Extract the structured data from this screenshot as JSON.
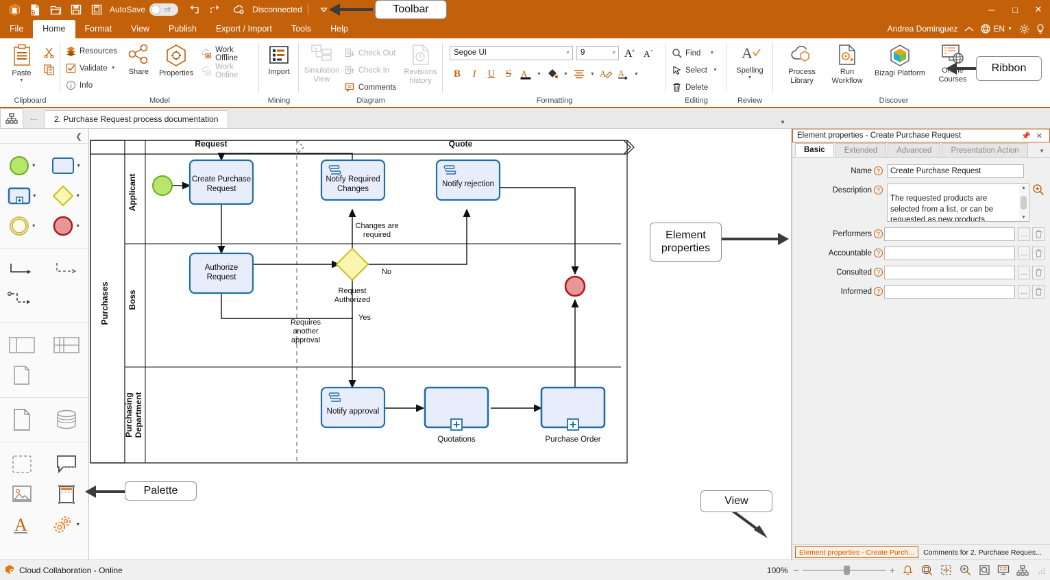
{
  "titlebar": {
    "icons": [
      "bizagi-logo-icon",
      "new-document-icon",
      "open-folder-icon",
      "save-icon",
      "save-as-icon"
    ],
    "autosave_label": "AutoSave",
    "autosave_state": "off",
    "undo_label": "undo-icon",
    "redo_label": "redo-icon",
    "connection_status": "Disconnected",
    "customize_label": "customize-quick-access-icon",
    "window_controls": [
      "minimize",
      "maximize",
      "close"
    ]
  },
  "menu": {
    "items": [
      "File",
      "Home",
      "Format",
      "View",
      "Publish",
      "Export / Import",
      "Tools",
      "Help"
    ],
    "active": "Home",
    "user": "Andrea Dominguez",
    "language": "EN",
    "right_icons": [
      "collapse-ribbon-icon",
      "globe-icon",
      "settings-gear-icon",
      "lightbulb-icon"
    ]
  },
  "ribbon": {
    "groups": [
      {
        "title": "Clipboard",
        "big": [
          {
            "label": "Paste",
            "icon": "paste-icon",
            "has_arrow": true,
            "disabled": false
          }
        ],
        "small": [
          {
            "label": "",
            "icon": "cut-icon",
            "disabled": false
          },
          {
            "label": "",
            "icon": "copy-icon",
            "disabled": false
          }
        ]
      },
      {
        "title": "Model",
        "small_left": [
          {
            "label": "Resources",
            "icon": "resources-icon",
            "disabled": false,
            "arrow": false
          },
          {
            "label": "Validate",
            "icon": "validate-icon",
            "disabled": false,
            "arrow": true
          },
          {
            "label": "Info",
            "icon": "info-icon",
            "disabled": false,
            "arrow": false
          }
        ],
        "big": [
          {
            "label": "Share",
            "icon": "share-icon",
            "disabled": false
          },
          {
            "label": "Properties",
            "icon": "properties-gear-icon",
            "disabled": false
          }
        ],
        "small_right": [
          {
            "label": "Work Offline",
            "icon": "work-offline-icon",
            "disabled": false
          },
          {
            "label": "Work Online",
            "icon": "work-online-icon",
            "disabled": true
          }
        ]
      },
      {
        "title": "Mining",
        "big": [
          {
            "label": "Import",
            "icon": "import-icon",
            "disabled": false
          }
        ]
      },
      {
        "title": "Diagram",
        "big": [
          {
            "label": "Simulation View",
            "icon": "simulation-view-icon",
            "disabled": true
          },
          {
            "label": "Revisions history",
            "icon": "revisions-history-icon",
            "disabled": true
          }
        ],
        "small": [
          {
            "label": "Check Out",
            "icon": "check-out-icon",
            "disabled": true
          },
          {
            "label": "Check In",
            "icon": "check-in-icon",
            "disabled": true
          },
          {
            "label": "Comments",
            "icon": "comments-icon",
            "disabled": false
          }
        ]
      },
      {
        "title": "Formatting",
        "font_family": "Segoe UI",
        "font_size": "9",
        "grow_font": "increase-font-size-icon",
        "shrink_font": "decrease-font-size-icon",
        "buttons": [
          "bold",
          "italic",
          "underline",
          "strikethrough",
          "font-color",
          "fill-color",
          "align",
          "clear-format",
          "text-direction"
        ]
      },
      {
        "title": "Editing",
        "small": [
          {
            "label": "Find",
            "icon": "find-icon",
            "arrow": true
          },
          {
            "label": "Select",
            "icon": "select-icon",
            "arrow": true
          },
          {
            "label": "Delete",
            "icon": "delete-trash-icon",
            "arrow": false
          }
        ]
      },
      {
        "title": "Review",
        "big": [
          {
            "label": "Spelling",
            "icon": "spelling-icon",
            "has_arrow": true
          }
        ]
      },
      {
        "title": "Discover",
        "big": [
          {
            "label": "Process Library",
            "icon": "process-library-icon"
          },
          {
            "label": "Run Workflow",
            "icon": "run-workflow-icon"
          },
          {
            "label": "Bizagi Platform",
            "icon": "bizagi-platform-icon"
          },
          {
            "label": "Online Courses",
            "icon": "online-courses-icon"
          }
        ]
      }
    ]
  },
  "tabstrip": {
    "view_icon": "diagram-view-icon",
    "back_icon": "back-arrow-icon",
    "document_tab": "2. Purchase Request process documentation",
    "overflow_icon": "chevron-down-icon"
  },
  "palette": {
    "collapse_icon": "collapse-palette-icon",
    "sections": [
      {
        "rows": [
          [
            {
              "name": "start-event-shape",
              "icon": "start-event",
              "arrow": true
            },
            {
              "name": "task-shape",
              "icon": "task",
              "arrow": true
            }
          ],
          [
            {
              "name": "subprocess-shape",
              "icon": "subprocess",
              "arrow": true
            },
            {
              "name": "gateway-shape",
              "icon": "gateway",
              "arrow": true
            }
          ],
          [
            {
              "name": "intermediate-event-shape",
              "icon": "intermediate-event",
              "arrow": true
            },
            {
              "name": "end-event-shape",
              "icon": "end-event",
              "arrow": true
            }
          ]
        ]
      },
      {
        "rows": [
          [
            {
              "name": "sequence-flow-connector",
              "icon": "sequence-flow",
              "arrow": false
            },
            {
              "name": "message-flow-connector",
              "icon": "message-flow",
              "arrow": false
            }
          ],
          [
            {
              "name": "association-connector",
              "icon": "association",
              "arrow": false
            },
            {
              "name": "empty-cell",
              "icon": "empty",
              "arrow": false
            }
          ]
        ]
      },
      {
        "rows": [
          [
            {
              "name": "pool-shape",
              "icon": "pool",
              "arrow": false
            },
            {
              "name": "lane-shape",
              "icon": "lane",
              "arrow": false
            }
          ],
          [
            {
              "name": "milestone-shape",
              "icon": "milestone",
              "arrow": false
            },
            {
              "name": "empty-cell",
              "icon": "empty",
              "arrow": false
            }
          ]
        ]
      },
      {
        "rows": [
          [
            {
              "name": "data-object-shape",
              "icon": "data-object",
              "arrow": false
            },
            {
              "name": "data-store-shape",
              "icon": "data-store",
              "arrow": false
            }
          ]
        ]
      },
      {
        "rows": [
          [
            {
              "name": "group-shape",
              "icon": "group",
              "arrow": false
            },
            {
              "name": "annotation-shape",
              "icon": "annotation",
              "arrow": false
            }
          ],
          [
            {
              "name": "image-shape",
              "icon": "image",
              "arrow": false
            },
            {
              "name": "artifact-shape",
              "icon": "artifact",
              "arrow": false
            }
          ],
          [
            {
              "name": "text-shape",
              "icon": "text-a",
              "arrow": false
            },
            {
              "name": "custom-shapes",
              "icon": "gears",
              "arrow": true
            }
          ]
        ]
      }
    ]
  },
  "diagram": {
    "pool_label": "Purchases",
    "lanes": [
      "Applicant",
      "Boss",
      "Purchasing Department"
    ],
    "milestones": [
      "Request",
      "Quote"
    ],
    "nodes": [
      {
        "id": "start",
        "type": "start-event",
        "label": ""
      },
      {
        "id": "create",
        "type": "task",
        "label": "Create Purchase Request"
      },
      {
        "id": "authorize",
        "type": "task",
        "label": "Authorize Request"
      },
      {
        "id": "gateway",
        "type": "gateway",
        "label": "Request Authorized"
      },
      {
        "id": "notify-changes",
        "type": "user-task",
        "label": "Notify Required Changes"
      },
      {
        "id": "notify-rejection",
        "type": "user-task",
        "label": "Notify rejection"
      },
      {
        "id": "notify-approval",
        "type": "user-task",
        "label": "Notify approval"
      },
      {
        "id": "quotations",
        "type": "subprocess",
        "label": "Quotations"
      },
      {
        "id": "purchase-order",
        "type": "subprocess",
        "label": "Purchase Order"
      },
      {
        "id": "end",
        "type": "end-event",
        "label": ""
      }
    ],
    "flow_labels": [
      "Changes are required",
      "No",
      "Yes",
      "Requires another approval"
    ]
  },
  "properties": {
    "title": "Element properties - Create Purchase Request",
    "pin_icon": "pin-icon",
    "close_icon": "close-icon",
    "tabs": [
      "Basic",
      "Extended",
      "Advanced",
      "Presentation Action"
    ],
    "active_tab": "Basic",
    "overflow_icon": "chevron-down-icon",
    "fields": [
      {
        "label": "Name",
        "value": "Create Purchase Request",
        "type": "text"
      },
      {
        "label": "Description",
        "value": "The requested products are selected from a list, or can be requested as new products",
        "type": "textarea"
      },
      {
        "label": "Performers",
        "value": "",
        "type": "picker"
      },
      {
        "label": "Accountable",
        "value": "",
        "type": "picker"
      },
      {
        "label": "Consulted",
        "value": "",
        "type": "picker"
      },
      {
        "label": "Informed",
        "value": "",
        "type": "picker"
      }
    ],
    "bottom_tabs": [
      {
        "label": "Element properties - Create Purch...",
        "selected": true
      },
      {
        "label": "Comments for 2. Purchase Reques...",
        "selected": false
      }
    ]
  },
  "statusbar": {
    "collab_label": "Cloud Collaboration - Online",
    "collab_icon": "cloud-collab-icon",
    "zoom_value": "100%",
    "zoom_out": "−",
    "zoom_in": "+",
    "icons": [
      "alerts-bell-icon",
      "zoom-selection-icon",
      "fit-to-page-icon",
      "zoom-in-icon",
      "zoom-region-icon",
      "presentation-view-icon",
      "diagram-view-icon"
    ]
  },
  "callouts": [
    {
      "id": "toolbar-callout",
      "label": "Toolbar"
    },
    {
      "id": "ribbon-callout",
      "label": "Ribbon"
    },
    {
      "id": "element-properties-callout",
      "label": "Element properties"
    },
    {
      "id": "palette-callout",
      "label": "Palette"
    },
    {
      "id": "view-callout",
      "label": "View"
    }
  ],
  "colors": {
    "brand": "#C3610B",
    "task_fill": "#E8EDFB",
    "task_stroke": "#1F6FA5",
    "start_fill": "#A8E05A",
    "start_stroke": "#5EA716",
    "end_fill": "#E89797",
    "end_stroke": "#A81C20",
    "gateway_fill": "#FAF5B0",
    "gateway_stroke": "#C0C41E"
  }
}
